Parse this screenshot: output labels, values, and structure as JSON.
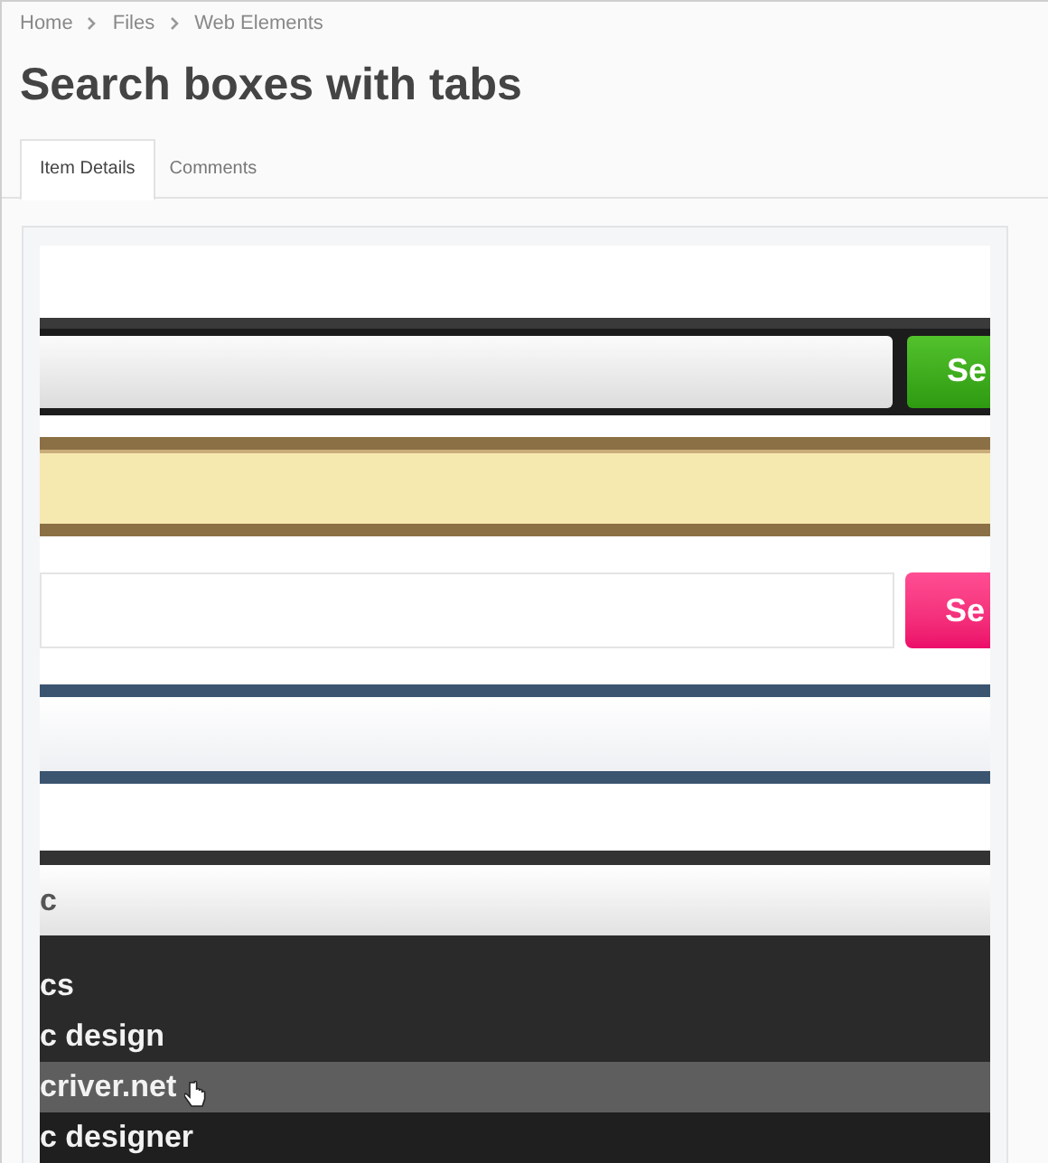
{
  "breadcrumb": [
    "Home",
    "Files",
    "Web Elements"
  ],
  "title": "Search boxes with tabs",
  "tabs": [
    {
      "label": "Item Details",
      "selected": true
    },
    {
      "label": "Comments",
      "selected": false
    }
  ],
  "preview": {
    "bars": [
      {
        "kind": "dark",
        "button": "Se"
      },
      {
        "kind": "gold"
      },
      {
        "kind": "light",
        "button": "Se"
      },
      {
        "kind": "blue"
      },
      {
        "kind": "menu",
        "query": "c",
        "items": [
          {
            "label": "cs",
            "selected": false
          },
          {
            "label": "c design",
            "selected": false
          },
          {
            "label": "criver.net",
            "selected": true
          },
          {
            "label": "c designer",
            "selected": false
          }
        ]
      }
    ]
  }
}
